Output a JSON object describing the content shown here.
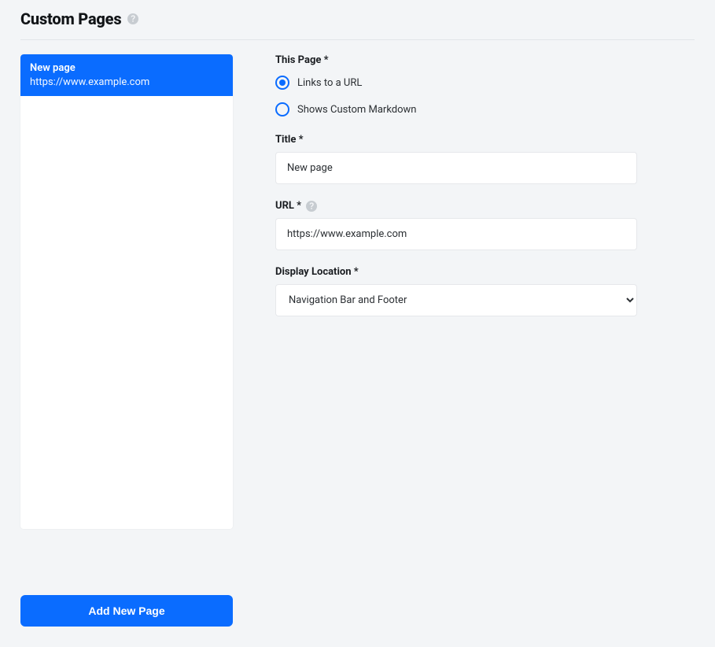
{
  "header": {
    "title": "Custom Pages"
  },
  "sidebar": {
    "pages": [
      {
        "title": "New page",
        "subtitle": "https://www.example.com",
        "selected": true
      }
    ],
    "add_button_label": "Add New Page"
  },
  "form": {
    "this_page": {
      "label": "This Page *",
      "options": [
        {
          "label": "Links to a URL",
          "checked": true
        },
        {
          "label": "Shows Custom Markdown",
          "checked": false
        }
      ]
    },
    "title_field": {
      "label": "Title *",
      "value": "New page"
    },
    "url_field": {
      "label": "URL *",
      "value": "https://www.example.com"
    },
    "display_location": {
      "label": "Display Location *",
      "selected": "Navigation Bar and Footer",
      "options": [
        "Navigation Bar and Footer"
      ]
    }
  }
}
